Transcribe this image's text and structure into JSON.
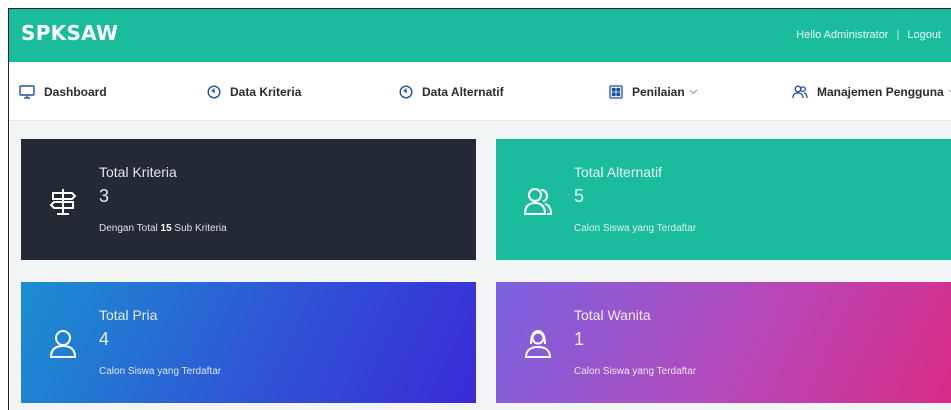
{
  "header": {
    "brand": "SPKSAW",
    "greeting": "Hello Administrator",
    "separator": "|",
    "logout": "Logout"
  },
  "nav": {
    "items": [
      {
        "label": "Dashboard",
        "icon": "monitor-icon"
      },
      {
        "label": "Data Kriteria",
        "icon": "clock-icon"
      },
      {
        "label": "Data Alternatif",
        "icon": "clock-icon"
      },
      {
        "label": "Penilaian",
        "icon": "grid-icon"
      },
      {
        "label": "Manajemen Pengguna",
        "icon": "users-icon"
      }
    ]
  },
  "cards": [
    {
      "label": "Total Kriteria",
      "value": "3",
      "desc_prefix": "Dengan Total ",
      "desc_bold": "15",
      "desc_suffix": " Sub Kriteria",
      "icon": "signpost-icon",
      "color": "#232a36"
    },
    {
      "label": "Total Alternatif",
      "value": "5",
      "desc": "Calon Siswa yang Terdaftar",
      "icon": "users-icon",
      "color": "#1abc9c"
    },
    {
      "label": "Total Pria",
      "value": "4",
      "desc": "Calon Siswa yang Terdaftar",
      "icon": "user-icon",
      "color": "#2f54d6"
    },
    {
      "label": "Total Wanita",
      "value": "1",
      "desc": "Calon Siswa yang Terdaftar",
      "icon": "user-female-icon",
      "color": "#b648b9"
    }
  ],
  "colors": {
    "accent": "#1abc9c",
    "dark_card": "#232a36"
  }
}
